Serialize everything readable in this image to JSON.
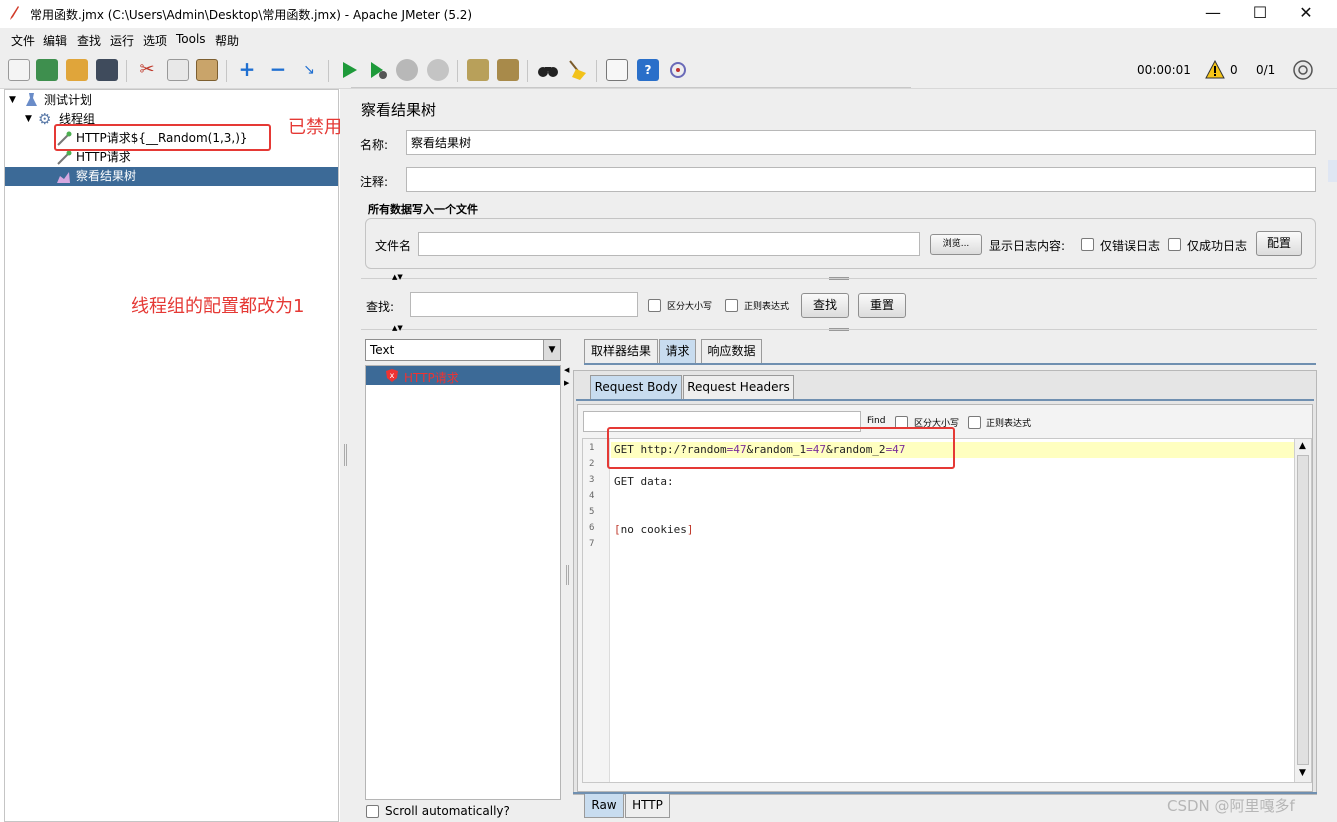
{
  "window": {
    "title": "常用函数.jmx (C:\\Users\\Admin\\Desktop\\常用函数.jmx) - Apache JMeter (5.2)",
    "minimize": "—",
    "maximize": "☐",
    "close": "✕"
  },
  "menu": [
    "文件",
    "编辑",
    "查找",
    "运行",
    "选项",
    "Tools",
    "帮助"
  ],
  "toolbar": {
    "timer": "00:00:01",
    "warnings": "0",
    "threads": "0/1"
  },
  "tree": {
    "items": [
      {
        "label": "测试计划",
        "icon": "test-plan-icon"
      },
      {
        "label": "线程组",
        "icon": "gear-icon"
      },
      {
        "label": "HTTP请求${__Random(1,3,)}",
        "icon": "pipette-icon"
      },
      {
        "label": "HTTP请求",
        "icon": "pipette-icon"
      },
      {
        "label": "察看结果树",
        "icon": "chart-icon"
      }
    ]
  },
  "annotations": {
    "disabled": "已禁用",
    "threadgroup_note": "线程组的配置都改为1"
  },
  "panel": {
    "title": "察看结果树",
    "name_label": "名称:",
    "name_value": "察看结果树",
    "comment_label": "注释:",
    "comment_value": "",
    "file_section_title": "所有数据写入一个文件",
    "filename_label": "文件名",
    "filename_value": "",
    "browse_button": "浏览...",
    "log_content_label": "显示日志内容:",
    "errors_only": "仅错误日志",
    "success_only": "仅成功日志",
    "configure_button": "配置"
  },
  "search": {
    "label": "查找:",
    "value": "",
    "case_sensitive": "区分大小写",
    "regex": "正则表达式",
    "find_button": "查找",
    "reset_button": "重置"
  },
  "results": {
    "renderer": "Text",
    "samples": [
      {
        "label": "HTTP请求"
      }
    ],
    "scroll_auto": "Scroll automatically?"
  },
  "tabs": [
    {
      "label": "取样器结果"
    },
    {
      "label": "请求",
      "active": true
    },
    {
      "label": "响应数据"
    }
  ],
  "subtabs": [
    {
      "label": "Request Body",
      "active": true
    },
    {
      "label": "Request Headers"
    }
  ],
  "find_bar": {
    "find_label": "Find",
    "case_sensitive": "区分大小写",
    "regex": "正则表达式",
    "value": ""
  },
  "code": {
    "lines": [
      {
        "n": "1",
        "text": "GET http:/?random=47&random_1=47&random_2=47"
      },
      {
        "n": "2",
        "text": ""
      },
      {
        "n": "3",
        "text": "GET data:"
      },
      {
        "n": "4",
        "text": ""
      },
      {
        "n": "5",
        "text": ""
      },
      {
        "n": "6",
        "text": "[no cookies]"
      },
      {
        "n": "7",
        "text": ""
      }
    ]
  },
  "bottom_tabs": [
    {
      "label": "Raw",
      "active": true
    },
    {
      "label": "HTTP"
    }
  ],
  "watermark": "CSDN @阿里嘎多f",
  "colors": {
    "selection": "#3c6a97",
    "annotation": "#e53935",
    "highlight": "#ffffc0",
    "tab_active": "#c8dcef"
  }
}
